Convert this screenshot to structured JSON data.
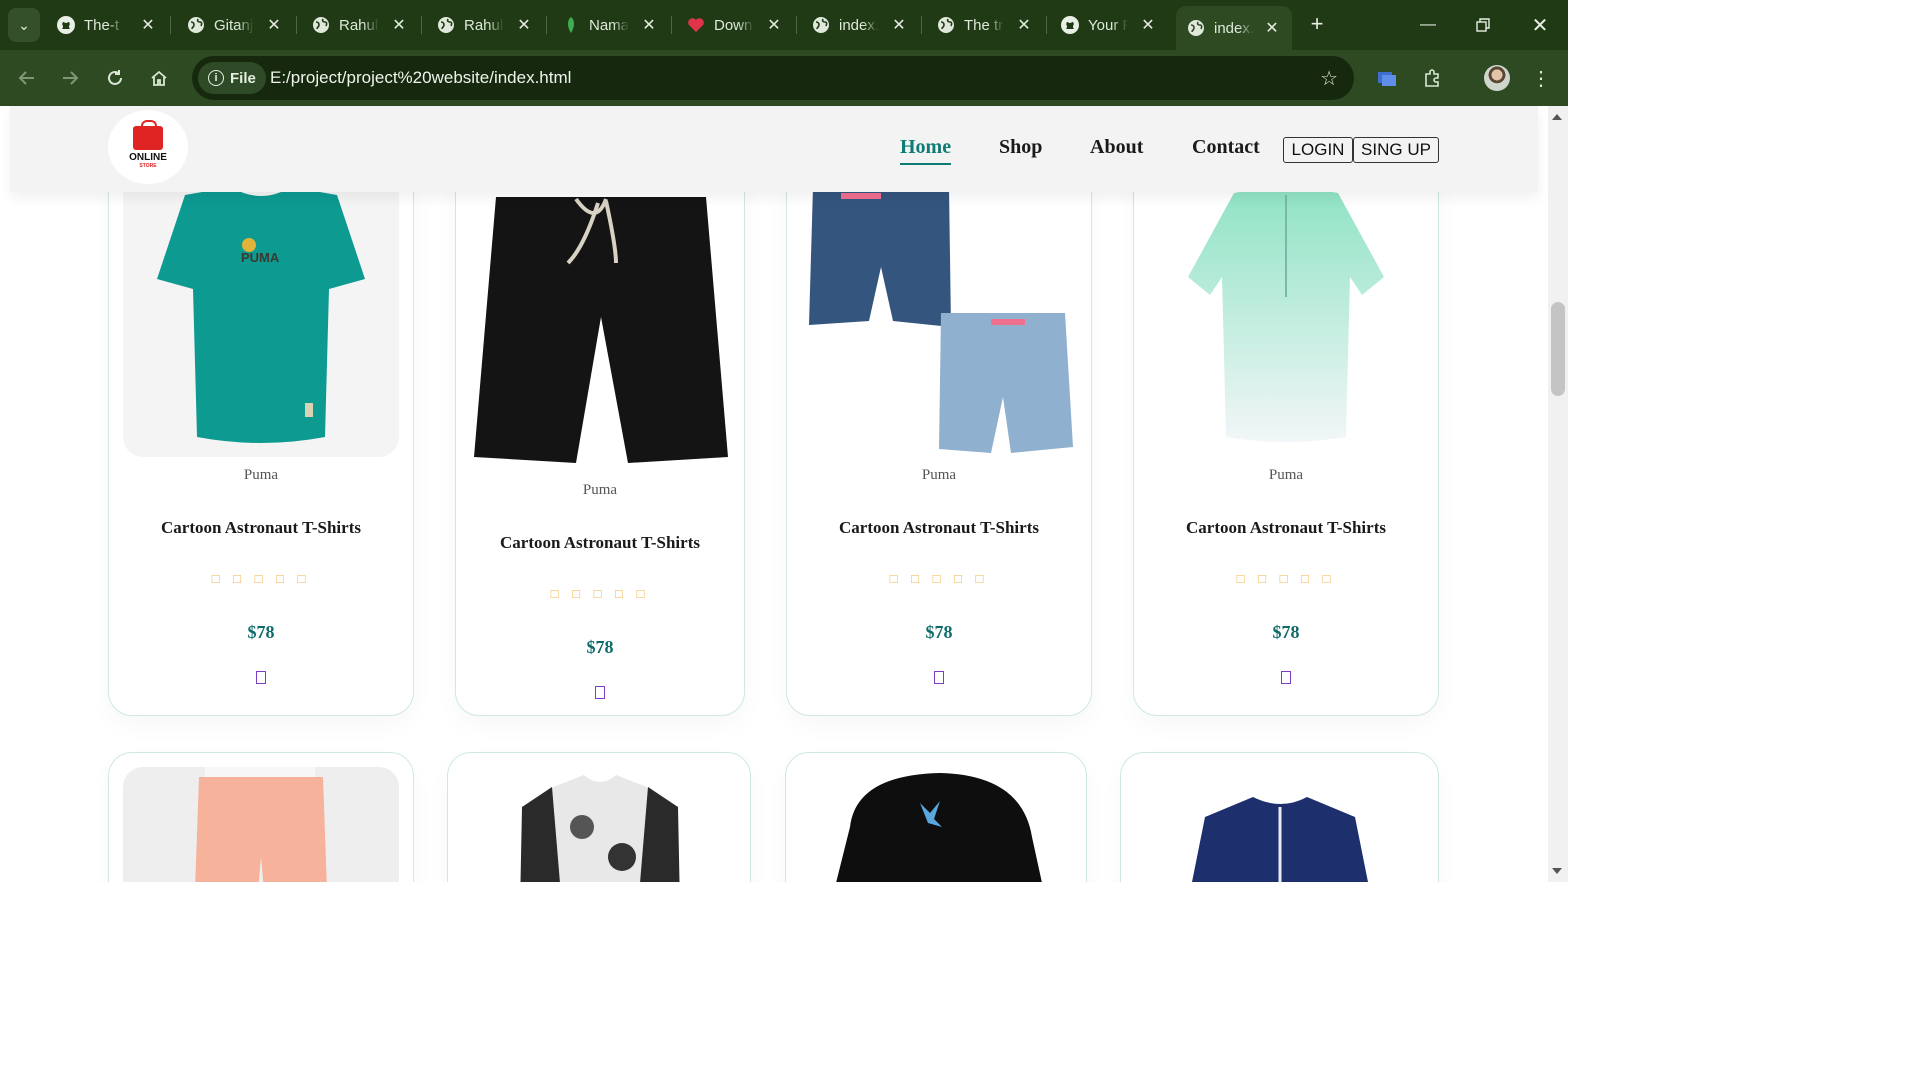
{
  "browser": {
    "tabs": [
      {
        "title": "The-t",
        "icon": "github-icon"
      },
      {
        "title": "Gitanj",
        "icon": "globe-icon"
      },
      {
        "title": "Rahul",
        "icon": "globe-icon"
      },
      {
        "title": "Rahul",
        "icon": "globe-icon"
      },
      {
        "title": "Nama",
        "icon": "leaf-icon"
      },
      {
        "title": "Down",
        "icon": "heart-icon"
      },
      {
        "title": "index.",
        "icon": "globe-icon"
      },
      {
        "title": "The tr",
        "icon": "globe-icon"
      },
      {
        "title": "Your F",
        "icon": "github-icon"
      },
      {
        "title": "index.",
        "icon": "globe-icon",
        "active": true
      }
    ],
    "new_tab": "+",
    "address": {
      "chip_label": "File",
      "url": "E:/project/project%20website/index.html"
    },
    "colors": {
      "frame": "#1f3a14",
      "toolbar": "#2d4a22",
      "omnibox": "#16290f"
    }
  },
  "site": {
    "logo": {
      "line1": "ONLINE",
      "line2": "STORE"
    },
    "nav": [
      "Home",
      "Shop",
      "About",
      "Contact"
    ],
    "active_nav": "Home",
    "login_label": "LOGIN",
    "signup_label": "SING UP",
    "accent_color": "#0f7b76"
  },
  "products_row1": [
    {
      "brand": "Puma",
      "name": "Cartoon Astronaut T-Shirts",
      "stars": "□ □ □ □ □",
      "price": "$78",
      "image": "teal-puma-tshirt"
    },
    {
      "brand": "Puma",
      "name": "Cartoon Astronaut T-Shirts",
      "stars": "□ □ □ □ □",
      "price": "$78",
      "image": "black-drawstring-shorts"
    },
    {
      "brand": "Puma",
      "name": "Cartoon Astronaut T-Shirts",
      "stars": "□ □ □ □ □",
      "price": "$78",
      "image": "denim-shorts-pair"
    },
    {
      "brand": "Puma",
      "name": "Cartoon Astronaut T-Shirts",
      "stars": "□ □ □ □ □",
      "price": "$78",
      "image": "mint-gradient-shirt"
    }
  ],
  "products_row2": [
    {
      "image": "peach-joggers"
    },
    {
      "image": "black-white-floral-top"
    },
    {
      "image": "black-butterfly-bucket-hat"
    },
    {
      "image": "navy-print-shirt"
    }
  ]
}
